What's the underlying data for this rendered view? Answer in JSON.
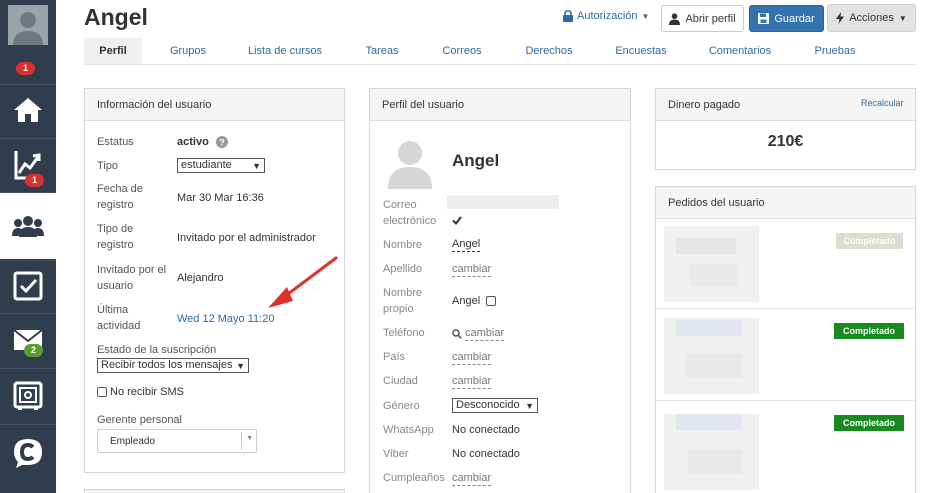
{
  "rail": {
    "badges": [
      "1",
      "1",
      "2"
    ],
    "icons": [
      "avatar-icon",
      "home-icon",
      "stats-icon",
      "users-icon",
      "tasks-icon",
      "mail-icon",
      "safe-icon",
      "chat-icon"
    ]
  },
  "header": {
    "title": "Angel",
    "authorization_label": "Autorización",
    "open_profile_label": "Abrir perfil",
    "save_label": "Guardar",
    "actions_label": "Acciones"
  },
  "tabs": [
    "Perfil",
    "Grupos",
    "Lista de cursos",
    "Tareas",
    "Correos",
    "Derechos",
    "Encuestas",
    "Comentarios",
    "Pruebas"
  ],
  "user_info": {
    "title": "Información del usuario",
    "status_label": "Estatus",
    "status_value": "activo",
    "type_label": "Tipo",
    "type_value": "estudiante",
    "reg_date_label": "Fecha de registro",
    "reg_date_value": "Mar 30 Mar 16:36",
    "reg_type_label": "Tipo de registro",
    "reg_type_value": "Invitado por el administrador",
    "invited_by_label": "Invitado por el usuario",
    "invited_by_value": "Alejandro",
    "last_activity_label": "Última actividad",
    "last_activity_value": "Wed 12 Mayo 11:20",
    "subscription_label": "Estado de la suscripción",
    "subscription_value": "Recibir todos los mensajes",
    "no_sms_label": "No recibir SMS",
    "manager_label": "Gerente personal",
    "manager_value": "Empleado"
  },
  "user_profile": {
    "title": "Perfil del usuario",
    "name": "Angel",
    "email_label": "Correo electrónico",
    "first_name_label": "Nombre",
    "first_name_value": "Angel",
    "last_name_label": "Apellido",
    "change_label": "cambiar",
    "own_name_label": "Nombre propio",
    "own_name_value": "Angel",
    "phone_label": "Teléfono",
    "country_label": "País",
    "city_label": "Ciudad",
    "gender_label": "Género",
    "gender_value": "Desconocido",
    "whatsapp_label": "WhatsApp",
    "whatsapp_value": "No conectado",
    "viber_label": "Viber",
    "viber_value": "No conectado",
    "birthday_label": "Cumpleaños"
  },
  "money": {
    "title": "Dinero pagado",
    "recalc_label": "Recalcular",
    "amount": "210€"
  },
  "orders": {
    "title": "Pedidos del usuario",
    "statuses": [
      "Completado",
      "Completado",
      "Completado"
    ]
  },
  "colors": {
    "rail_bg": "#2f3d4c",
    "link": "#2f6aa5",
    "primary": "#3572b0",
    "badge_red": "#d9322e",
    "badge_green": "#5f9c2f",
    "status_green": "#188a22",
    "arrow_red": "#e0302a"
  }
}
